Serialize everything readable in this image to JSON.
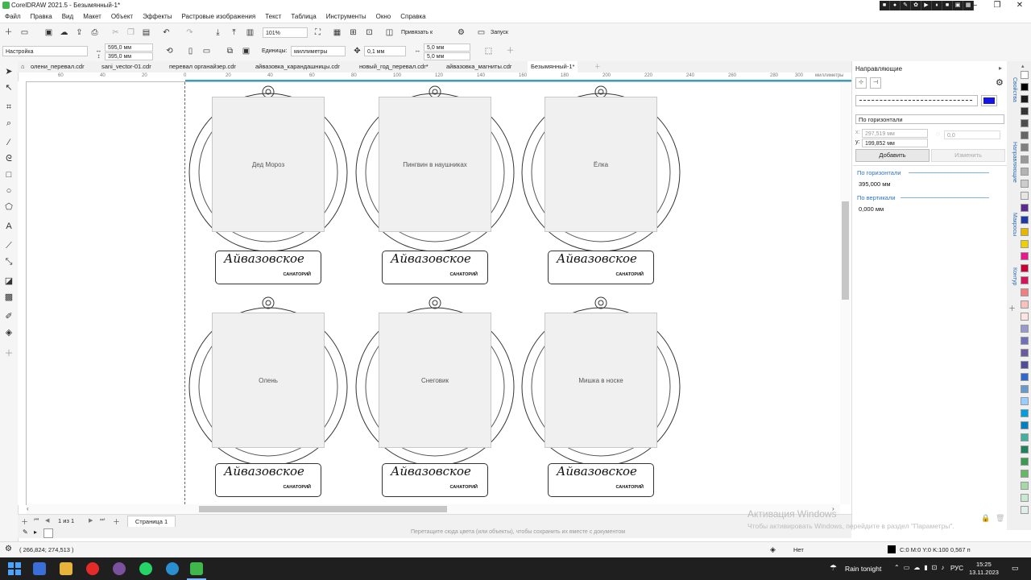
{
  "app": {
    "title": "CorelDRAW 2021.5 - Безымянный-1*",
    "window_controls": [
      "–",
      "❐",
      "✕"
    ]
  },
  "menu": [
    "Файл",
    "Правка",
    "Вид",
    "Макет",
    "Объект",
    "Эффекты",
    "Растровые изображения",
    "Текст",
    "Таблица",
    "Инструменты",
    "Окно",
    "Справка"
  ],
  "toolbar": {
    "zoom": "101%",
    "snap_label": "Привязать к",
    "launch_label": "Запуск"
  },
  "property_bar": {
    "preset": "Настройка",
    "width": "595,0 мм",
    "height": "395,0 мм",
    "units_label": "Единицы:",
    "units": "миллиметры",
    "nudge": "0,1 мм",
    "dup_x": "5,0 мм",
    "dup_y": "5,0 мм"
  },
  "tabs": [
    {
      "label": "олени_перевал.cdr",
      "active": false
    },
    {
      "label": "sani_vector-01.cdr",
      "active": false
    },
    {
      "label": "перевал органайзер.cdr",
      "active": false
    },
    {
      "label": "айвазовка_карандашницы.cdr",
      "active": false
    },
    {
      "label": "новый_год_перевал.cdr*",
      "active": false
    },
    {
      "label": "айвазовка_магниты.cdr",
      "active": false
    },
    {
      "label": "Безымянный-1*",
      "active": true
    }
  ],
  "ruler": {
    "labels": [
      "60",
      "40",
      "20",
      "0",
      "20",
      "40",
      "60",
      "80",
      "100",
      "120",
      "140",
      "160",
      "180",
      "200",
      "220",
      "240",
      "260",
      "280",
      "300",
      "миллиметры"
    ]
  },
  "ornaments": {
    "brand": "Айвазовское",
    "sub": "САНАТОРИЙ",
    "items": [
      {
        "art": "Дед Мороз"
      },
      {
        "art": "Пингвин в наушниках"
      },
      {
        "art": "Ёлка"
      },
      {
        "art": "Олень"
      },
      {
        "art": "Снеговик"
      },
      {
        "art": "Мишка в носке"
      }
    ]
  },
  "page_nav": {
    "counter": "1 из 1",
    "page_tab": "Страница 1"
  },
  "color_bar": {
    "hint": "Перетащите сюда цвета (или объекты), чтобы сохранить их вместе с документом"
  },
  "docker": {
    "title": "Направляющие",
    "orientation": "По горизонтали",
    "x": "297,519 мм",
    "y": "199,852 мм",
    "angle": "0,0",
    "add_button": "Добавить",
    "change_button": "Изменить",
    "horizontal_section": "По горизонтали",
    "horizontal_value": "395,000 мм",
    "vertical_section": "По вертикали",
    "vertical_value": "0,000 мм",
    "side_tabs": [
      "Свойства",
      "Направляющие",
      "Макросы",
      "Контур"
    ],
    "line_color": "#1515e6"
  },
  "status": {
    "coords": "( 266,824; 274,513 )",
    "fill_label": "Нет",
    "outline": "C:0 M:0 Y:0 K:100  0,567 п"
  },
  "watermark": {
    "title": "Активация Windows",
    "text": "Чтобы активировать Windows, перейдите в раздел \"Параметры\"."
  },
  "taskbar": {
    "weather": "Rain tonight",
    "lang": "РУС",
    "time": "15:25",
    "date": "13.11.2023"
  },
  "palette_colors": [
    "#ffffff",
    "#000000",
    "#1a1a1a",
    "#333333",
    "#4d4d4d",
    "#666666",
    "#808080",
    "#999999",
    "#b3b3b3",
    "#cccccc",
    "#e6e6e6",
    "#5b2c8e",
    "#1f3aa6",
    "#e6b800",
    "#f0d000",
    "#e61a8c",
    "#cc0033",
    "#d4145a",
    "#f08080",
    "#f9c0c0",
    "#ffe4e4",
    "#9999cc",
    "#7070b8",
    "#6b5b9e",
    "#4d4d99",
    "#3366cc",
    "#6699cc",
    "#99ccff",
    "#00a0e0",
    "#0080c0",
    "#40b0a0",
    "#208060",
    "#3c9a50",
    "#66b866",
    "#a8d8a8",
    "#c8e8d0",
    "#e0f0e8"
  ]
}
